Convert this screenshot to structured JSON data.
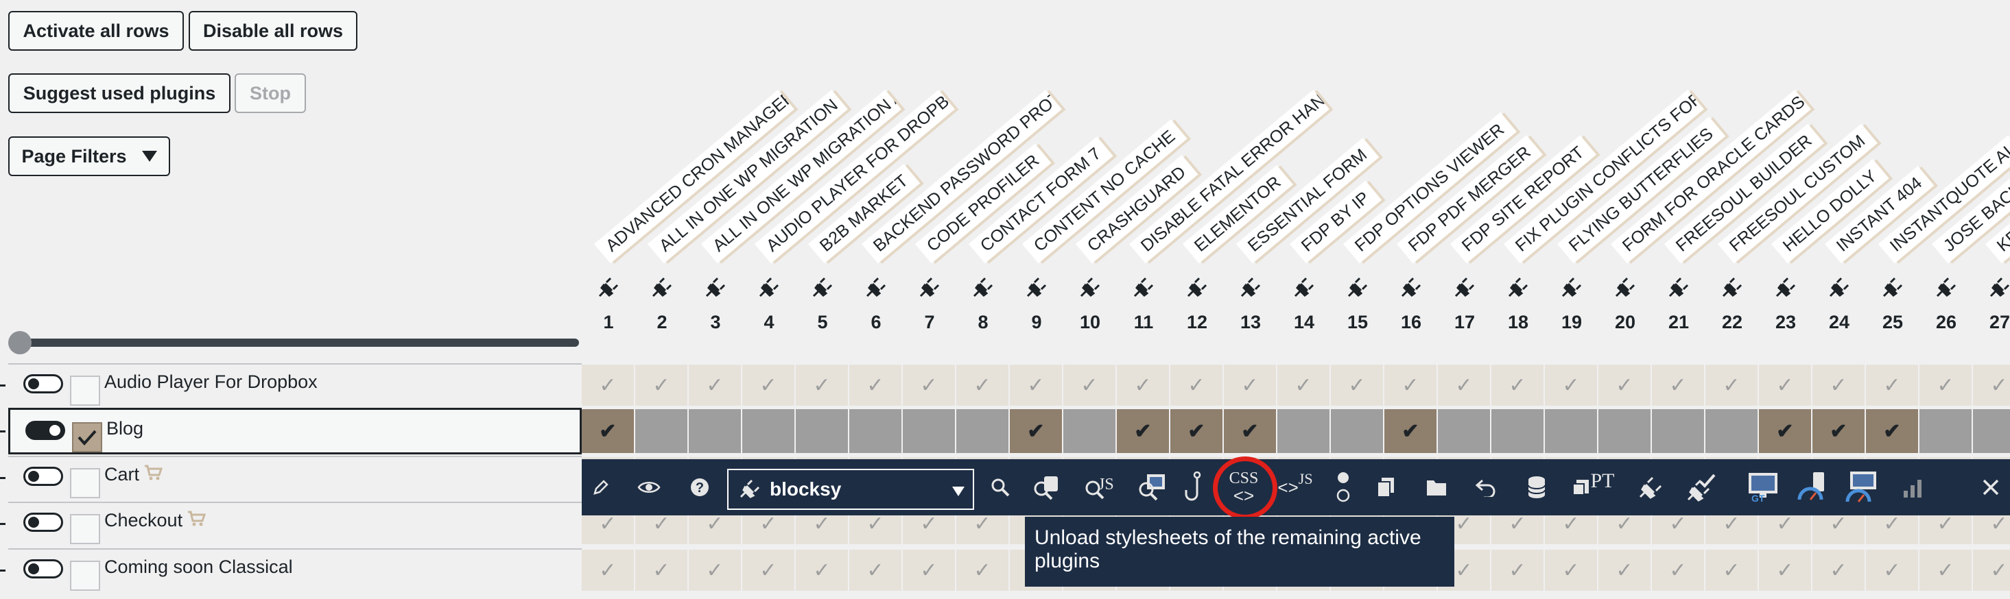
{
  "buttons": {
    "activate_all": "Activate all rows",
    "disable_all": "Disable all rows",
    "suggest": "Suggest used plugins",
    "stop": "Stop",
    "page_filters": "Page Filters"
  },
  "plugins": [
    {
      "n": "1",
      "name": "ADVANCED CRON MANAGER"
    },
    {
      "n": "2",
      "name": "ALL IN ONE WP MIGRATION UNLI ..."
    },
    {
      "n": "3",
      "name": "ALL IN ONE WP MIGRATION AND ..."
    },
    {
      "n": "4",
      "name": "AUDIO PLAYER FOR DROPBOX"
    },
    {
      "n": "5",
      "name": "B2B MARKET"
    },
    {
      "n": "6",
      "name": "BACKEND PASSWORD PROTECT"
    },
    {
      "n": "7",
      "name": "CODE PROFILER"
    },
    {
      "n": "8",
      "name": "CONTACT FORM 7"
    },
    {
      "n": "9",
      "name": "CONTENT NO CACHE"
    },
    {
      "n": "10",
      "name": "CRASHGUARD"
    },
    {
      "n": "11",
      "name": "DISABLE FATAL ERROR HANDLER"
    },
    {
      "n": "12",
      "name": "ELEMENTOR"
    },
    {
      "n": "13",
      "name": "ESSENTIAL FORM"
    },
    {
      "n": "14",
      "name": "FDP BY IP"
    },
    {
      "n": "15",
      "name": "FDP OPTIONS VIEWER"
    },
    {
      "n": "16",
      "name": "FDP PDF MERGER"
    },
    {
      "n": "17",
      "name": "FDP SITE REPORT"
    },
    {
      "n": "18",
      "name": "FIX PLUGIN CONFLICTS FOR CON ..."
    },
    {
      "n": "19",
      "name": "FLYING BUTTERFLIES"
    },
    {
      "n": "20",
      "name": "FORM FOR ORACLE CARDS"
    },
    {
      "n": "21",
      "name": "FREESOUL BUILDER"
    },
    {
      "n": "22",
      "name": "FREESOUL CUSTOM"
    },
    {
      "n": "23",
      "name": "HELLO DOLLY"
    },
    {
      "n": "24",
      "name": "INSTANT 404"
    },
    {
      "n": "25",
      "name": "INSTANTQUOTE AI"
    },
    {
      "n": "26",
      "name": "JOSE BACK"
    },
    {
      "n": "27",
      "name": "KE"
    }
  ],
  "rows": [
    {
      "label": "Audio Player For Dropbox",
      "toggle_on": false,
      "checked": false,
      "cart": false
    },
    {
      "label": "Blog",
      "toggle_on": true,
      "checked": true,
      "cart": false
    },
    {
      "label": "Cart",
      "toggle_on": false,
      "checked": false,
      "cart": true
    },
    {
      "label": "Checkout",
      "toggle_on": false,
      "checked": false,
      "cart": true
    },
    {
      "label": "Coming soon Classical",
      "toggle_on": false,
      "checked": false,
      "cart": false
    }
  ],
  "blog_active_columns": [
    1,
    9,
    11,
    12,
    13,
    16,
    23,
    24,
    25
  ],
  "toolbar": {
    "plugin_select": "blocksy",
    "css_label": "CSS",
    "js_label": "JS",
    "pt_label": "PT",
    "tooltip": "Unload stylesheets of the remaining active plugins"
  },
  "colors": {
    "toolbar_bg": "#1d2d44",
    "active_cell": "#8f7f6d",
    "highlight": "#e0201a"
  }
}
